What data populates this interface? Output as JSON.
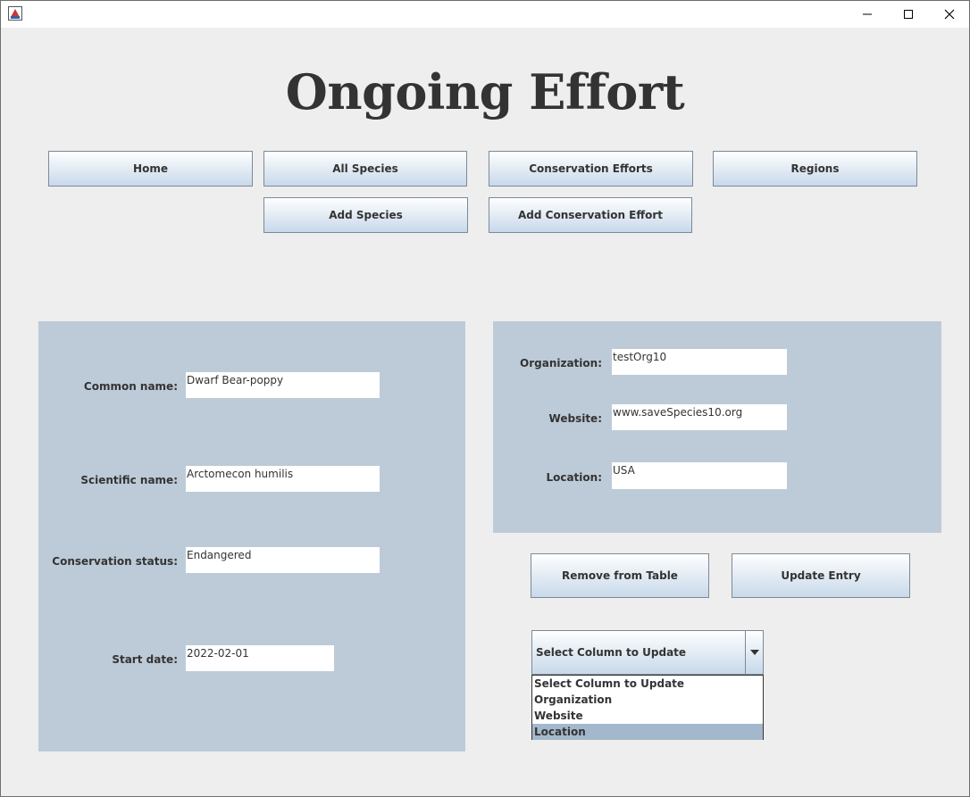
{
  "heading": "Ongoing Effort",
  "nav": {
    "home": "Home",
    "all_species": "All Species",
    "conservation_efforts": "Conservation Efforts",
    "regions": "Regions",
    "add_species": "Add Species",
    "add_conservation_effort": "Add Conservation Effort"
  },
  "species_form": {
    "common_name_label": "Common name:",
    "common_name_value": "Dwarf Bear-poppy",
    "scientific_name_label": "Scientific name:",
    "scientific_name_value": "Arctomecon humilis",
    "conservation_status_label": "Conservation status:",
    "conservation_status_value": "Endangered",
    "start_date_label": "Start date:",
    "start_date_value": "2022-02-01"
  },
  "org_form": {
    "organization_label": "Organization:",
    "organization_value": "testOrg10",
    "website_label": "Website:",
    "website_value": "www.saveSpecies10.org",
    "location_label": "Location:",
    "location_value": "USA"
  },
  "actions": {
    "remove": "Remove from Table",
    "update": "Update Entry"
  },
  "column_select": {
    "selected": "Select Column to Update",
    "options": [
      "Select Column to Update",
      "Organization",
      "Website",
      "Location"
    ],
    "highlighted": "Location"
  },
  "colors": {
    "panel": "#bdcbd8",
    "highlight": "#a3b8cc",
    "background": "#eeeeee"
  }
}
